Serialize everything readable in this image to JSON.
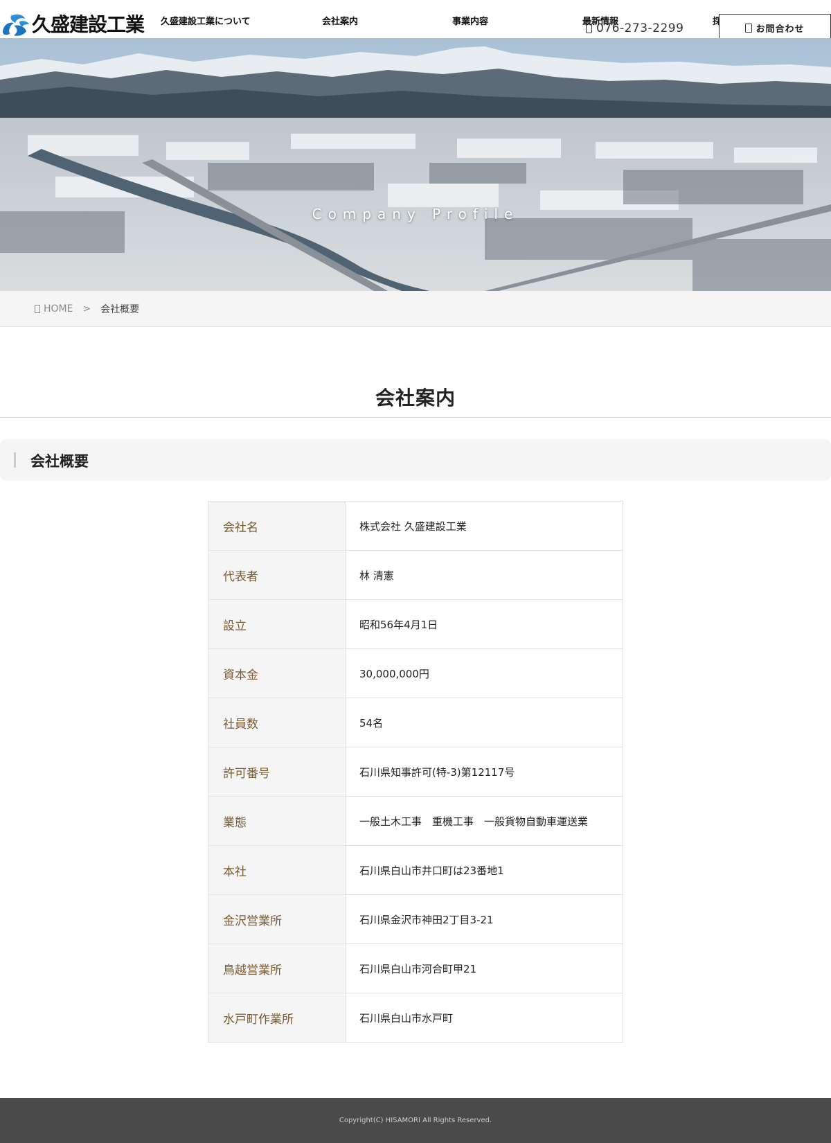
{
  "brand": {
    "name": "久盛建設工業",
    "logo_colors": [
      "#1e73be",
      "#2a8fd8"
    ]
  },
  "nav": {
    "items": [
      {
        "label": "久盛建設工業について"
      },
      {
        "label": "会社案内"
      },
      {
        "label": "事業内容"
      },
      {
        "label": "最新情報"
      },
      {
        "label": "採用情報"
      }
    ],
    "phone": "076-273-2299",
    "contact_label": "お問合わせ",
    "phone_icon": "phone-icon",
    "contact_icon": "mail-icon"
  },
  "hero": {
    "title": "Company Profile"
  },
  "breadcrumb": {
    "home": "HOME",
    "separator": ">",
    "current": "会社概要",
    "home_icon": "home-icon"
  },
  "page": {
    "title": "会社案内",
    "section_title": "会社概要"
  },
  "company_info": [
    {
      "label": "会社名",
      "value": "株式会社 久盛建設工業"
    },
    {
      "label": "代表者",
      "value": "林 清憲"
    },
    {
      "label": "設立",
      "value": "昭和56年4月1日"
    },
    {
      "label": "資本金",
      "value": "30,000,000円"
    },
    {
      "label": "社員数",
      "value": "54名"
    },
    {
      "label": "許可番号",
      "value": "石川県知事許可(特-3)第12117号"
    },
    {
      "label": "業態",
      "value": "一般土木工事　重機工事　一般貨物自動車運送業"
    },
    {
      "label": "本社",
      "value": "石川県白山市井口町は23番地1"
    },
    {
      "label": "金沢営業所",
      "value": "石川県金沢市神田2丁目3-21"
    },
    {
      "label": "鳥越営業所",
      "value": "石川県白山市河合町甲21"
    },
    {
      "label": "水戸町作業所",
      "value": "石川県白山市水戸町"
    }
  ],
  "footer": {
    "copyright": "Copyright(C) HISAMORI All Rights Reserved."
  },
  "colors": {
    "label_text": "#7a5a30",
    "label_bg": "#f5f5f5",
    "footer_bg": "#4a4a4a"
  }
}
